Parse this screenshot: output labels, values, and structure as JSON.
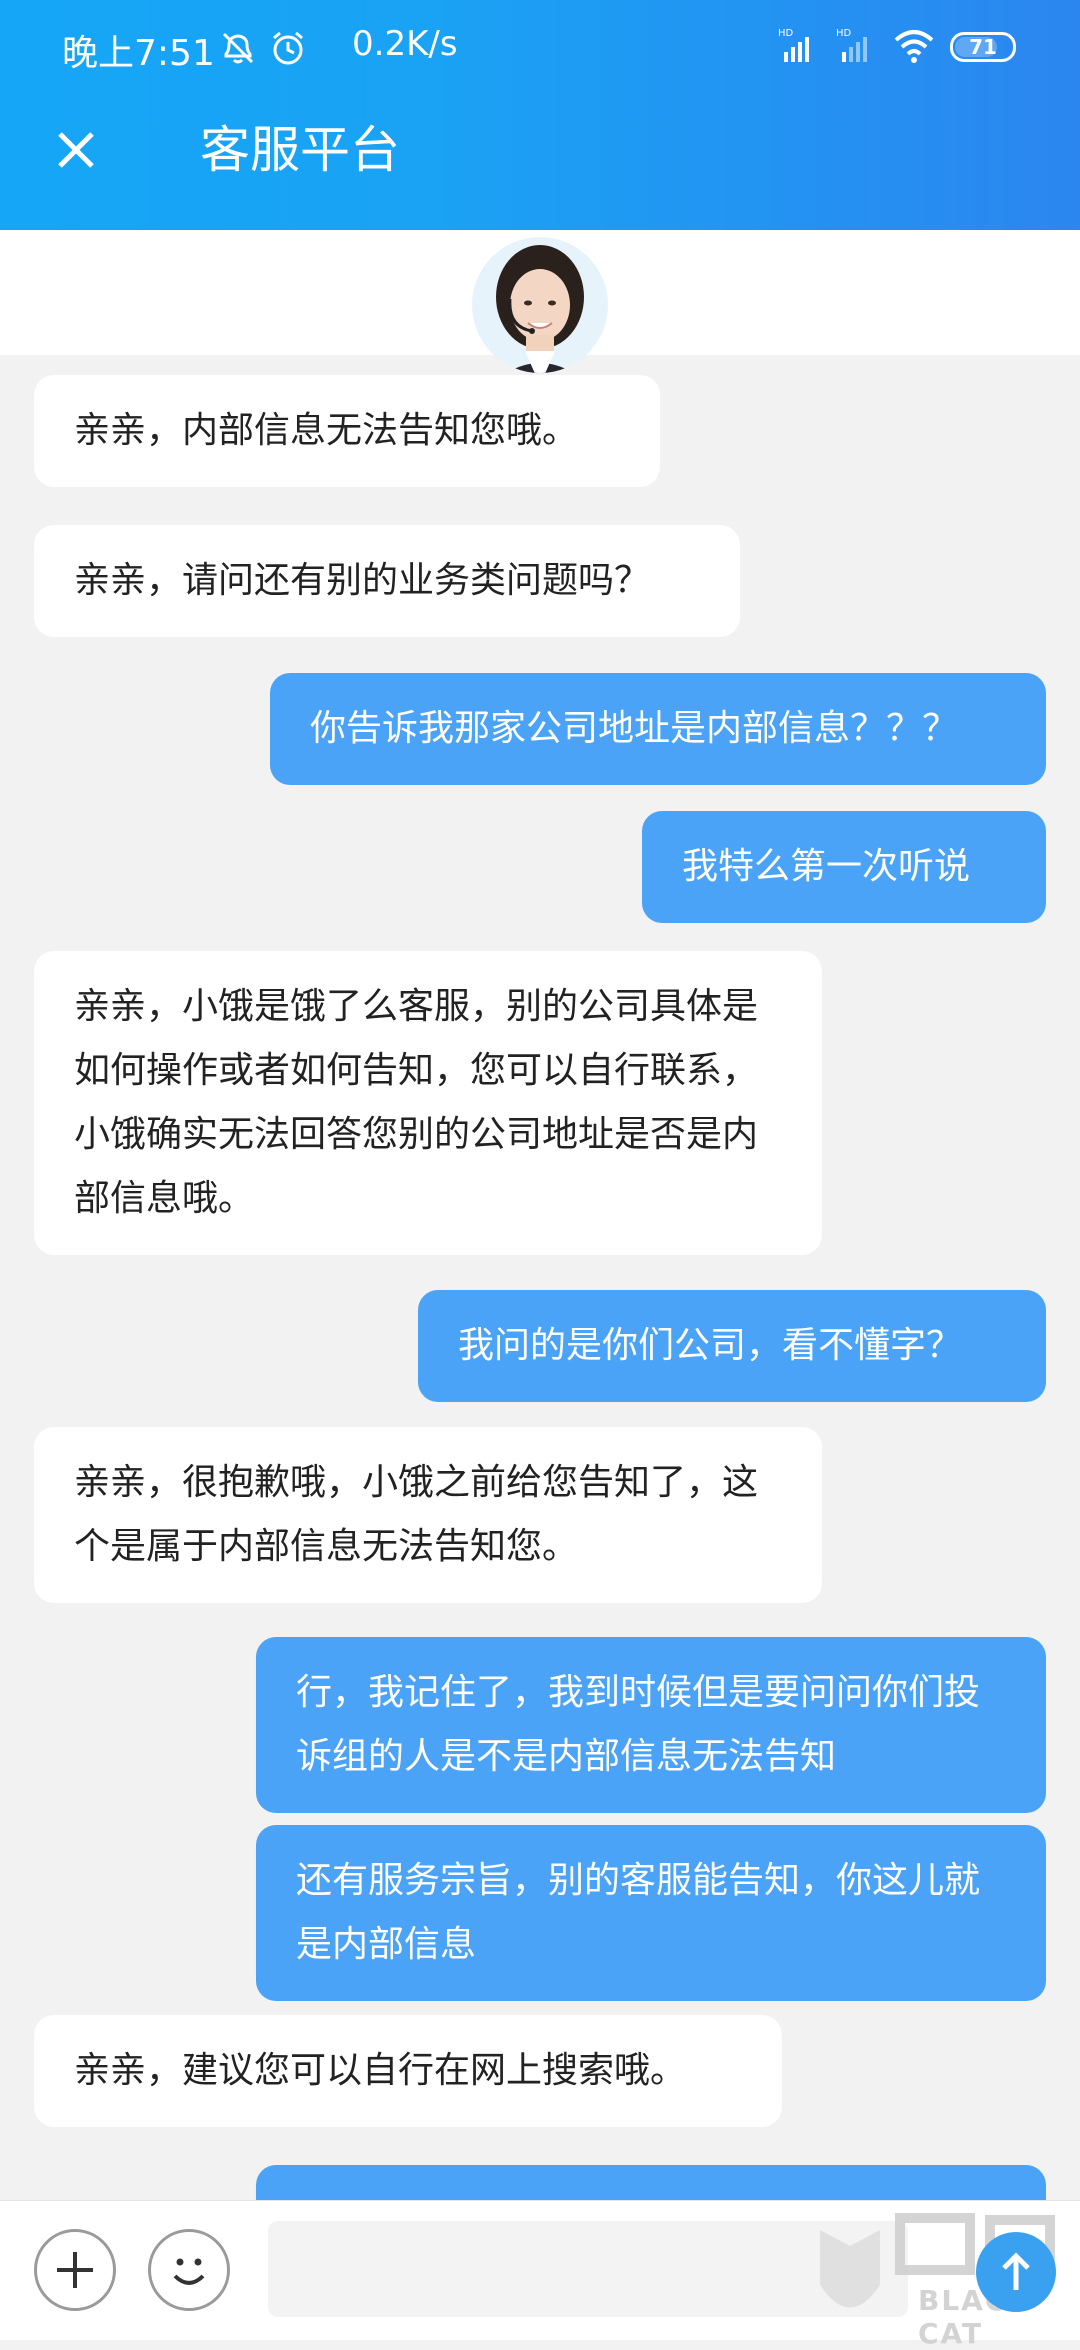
{
  "status_bar": {
    "time": "晚上7:51",
    "net_speed": "0.2K/s",
    "battery": "71"
  },
  "header": {
    "title": "客服平台"
  },
  "messages": [
    {
      "from": "agent",
      "text": "亲亲，内部信息无法告知您哦。"
    },
    {
      "from": "agent",
      "text": "亲亲，请问还有别的业务类问题吗？"
    },
    {
      "from": "user",
      "text": "你告诉我那家公司地址是内部信息？？？"
    },
    {
      "from": "user",
      "text": "我特么第一次听说"
    },
    {
      "from": "agent",
      "text": "亲亲，小饿是饿了么客服，别的公司具体是如何操作或者如何告知，您可以自行联系，小饿确实无法回答您别的公司地址是否是内部信息哦。"
    },
    {
      "from": "user",
      "text": "我问的是你们公司，看不懂字？"
    },
    {
      "from": "agent",
      "text": "亲亲，很抱歉哦，小饿之前给您告知了，这个是属于内部信息无法告知您。"
    },
    {
      "from": "user",
      "text": "行，我记住了，我到时候但是要问问你们投诉组的人是不是内部信息无法告知"
    },
    {
      "from": "user",
      "text": "还有服务宗旨，别的客服能告知，你这儿就是内部信息"
    },
    {
      "from": "agent",
      "text": "亲亲，建议您可以自行在网上搜索哦。"
    },
    {
      "from": "user",
      "text": ""
    }
  ],
  "input": {
    "value": "",
    "placeholder": ""
  },
  "watermark": {
    "text": "BLACK CAT"
  },
  "colors": {
    "header_start": "#16a6f7",
    "header_end": "#2b86f0",
    "user_bubble": "#4aa3f6",
    "agent_bubble": "#ffffff",
    "background": "#f2f2f2"
  }
}
